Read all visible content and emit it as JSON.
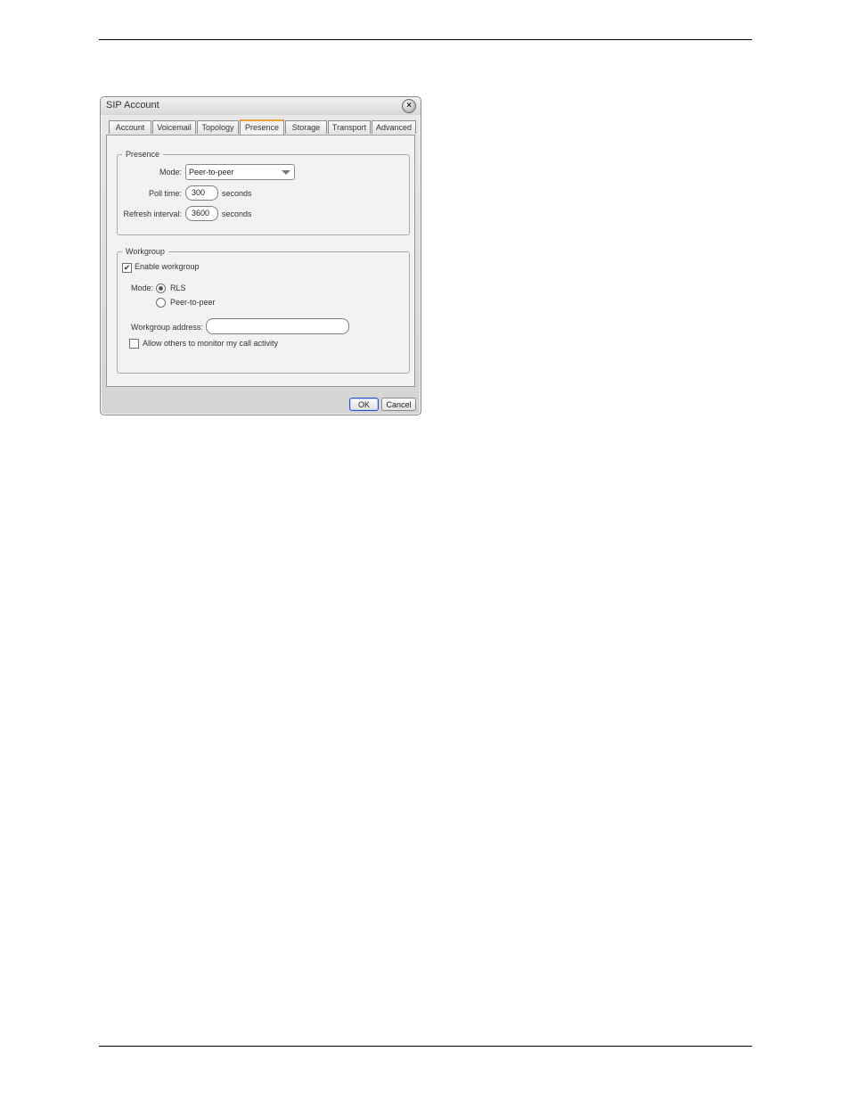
{
  "window": {
    "title": "SIP Account",
    "close_glyph": "×"
  },
  "tabs": [
    {
      "label": "Account"
    },
    {
      "label": "Voicemail"
    },
    {
      "label": "Topology"
    },
    {
      "label": "Presence",
      "active": true
    },
    {
      "label": "Storage"
    },
    {
      "label": "Transport"
    },
    {
      "label": "Advanced"
    }
  ],
  "presence": {
    "legend": "Presence",
    "mode_label": "Mode:",
    "mode_value": "Peer-to-peer",
    "poll_label": "Poll time:",
    "poll_value": "300",
    "poll_unit": "seconds",
    "refresh_label": "Refresh interval:",
    "refresh_value": "3600",
    "refresh_unit": "seconds"
  },
  "workgroup": {
    "legend": "Workgroup",
    "enable_label": "Enable workgroup",
    "enable_checked": true,
    "mode_label": "Mode:",
    "option_rls": "RLS",
    "option_p2p": "Peer-to-peer",
    "selected_mode": "RLS",
    "address_label": "Workgroup address:",
    "address_value": "",
    "allow_label": "Allow others to monitor my call activity",
    "allow_checked": false
  },
  "buttons": {
    "ok": "OK",
    "cancel": "Cancel"
  },
  "icons": {
    "close": "close-icon",
    "dropdown": "chevron-down-icon",
    "check": "checkmark-icon"
  },
  "colors": {
    "active_tab_accent": "#e8a23a",
    "default_button_border": "#2a4ec6"
  }
}
